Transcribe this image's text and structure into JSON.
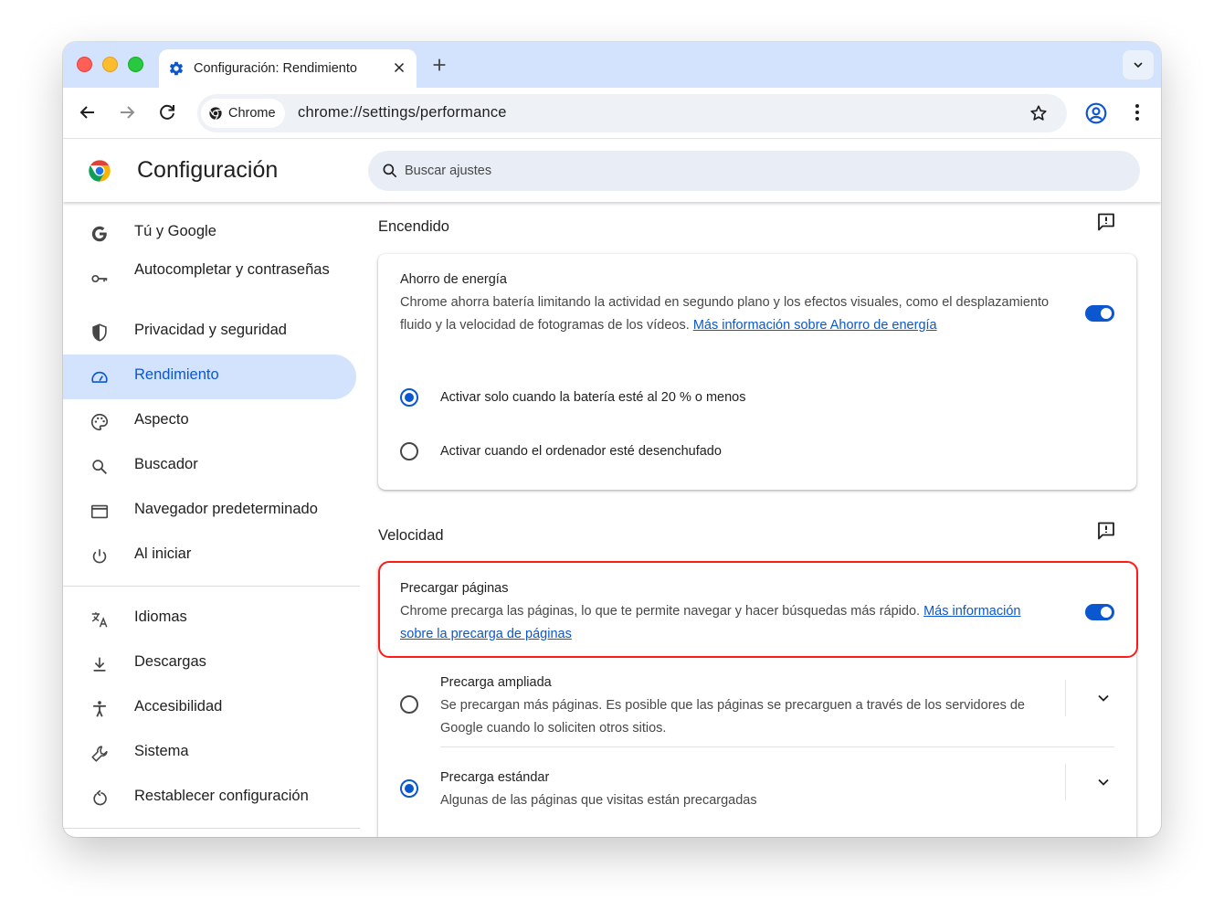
{
  "tab": {
    "title": "Configuración: Rendimiento",
    "icon": "gear-icon"
  },
  "omnibox": {
    "chip_label": "Chrome",
    "url": "chrome://settings/performance"
  },
  "header": {
    "title": "Configuración",
    "search_placeholder": "Buscar ajustes"
  },
  "sidebar": {
    "items": [
      {
        "label": "Tú y Google",
        "icon": "google-g-icon"
      },
      {
        "label": "Autocompletar y contraseñas",
        "icon": "key-icon"
      },
      {
        "label": "Privacidad y seguridad",
        "icon": "shield-icon"
      },
      {
        "label": "Rendimiento",
        "icon": "speedometer-icon",
        "active": true
      },
      {
        "label": "Aspecto",
        "icon": "palette-icon"
      },
      {
        "label": "Buscador",
        "icon": "search-icon"
      },
      {
        "label": "Navegador predeterminado",
        "icon": "browser-window-icon"
      },
      {
        "label": "Al iniciar",
        "icon": "power-icon"
      },
      {
        "label": "Idiomas",
        "icon": "translate-icon"
      },
      {
        "label": "Descargas",
        "icon": "download-icon"
      },
      {
        "label": "Accesibilidad",
        "icon": "accessibility-icon"
      },
      {
        "label": "Sistema",
        "icon": "wrench-icon"
      },
      {
        "label": "Restablecer configuración",
        "icon": "reset-icon"
      }
    ]
  },
  "power": {
    "section_title": "Encendido",
    "energy_saver": {
      "title": "Ahorro de energía",
      "desc": "Chrome ahorra batería limitando la actividad en segundo plano y los efectos visuales, como el desplazamiento fluido y la velocidad de fotogramas de los vídeos. ",
      "link": "Más información sobre Ahorro de energía",
      "enabled": true
    },
    "options": [
      {
        "label": "Activar solo cuando la batería esté al 20 % o menos",
        "checked": true
      },
      {
        "label": "Activar cuando el ordenador esté desenchufado",
        "checked": false
      }
    ]
  },
  "speed": {
    "section_title": "Velocidad",
    "preload": {
      "title": "Precargar páginas",
      "desc": "Chrome precarga las páginas, lo que te permite navegar y hacer búsquedas más rápido. ",
      "link": "Más información sobre la precarga de páginas",
      "enabled": true
    },
    "options": [
      {
        "title": "Precarga ampliada",
        "desc": "Se precargan más páginas. Es posible que las páginas se precarguen a través de los servidores de Google cuando lo soliciten otros sitios.",
        "checked": false
      },
      {
        "title": "Precarga estándar",
        "desc": "Algunas de las páginas que visitas están precargadas",
        "checked": true
      }
    ]
  },
  "colors": {
    "accent": "#0b57d0",
    "active_bg": "#d3e3fd",
    "highlight": "#ff1a1a"
  }
}
